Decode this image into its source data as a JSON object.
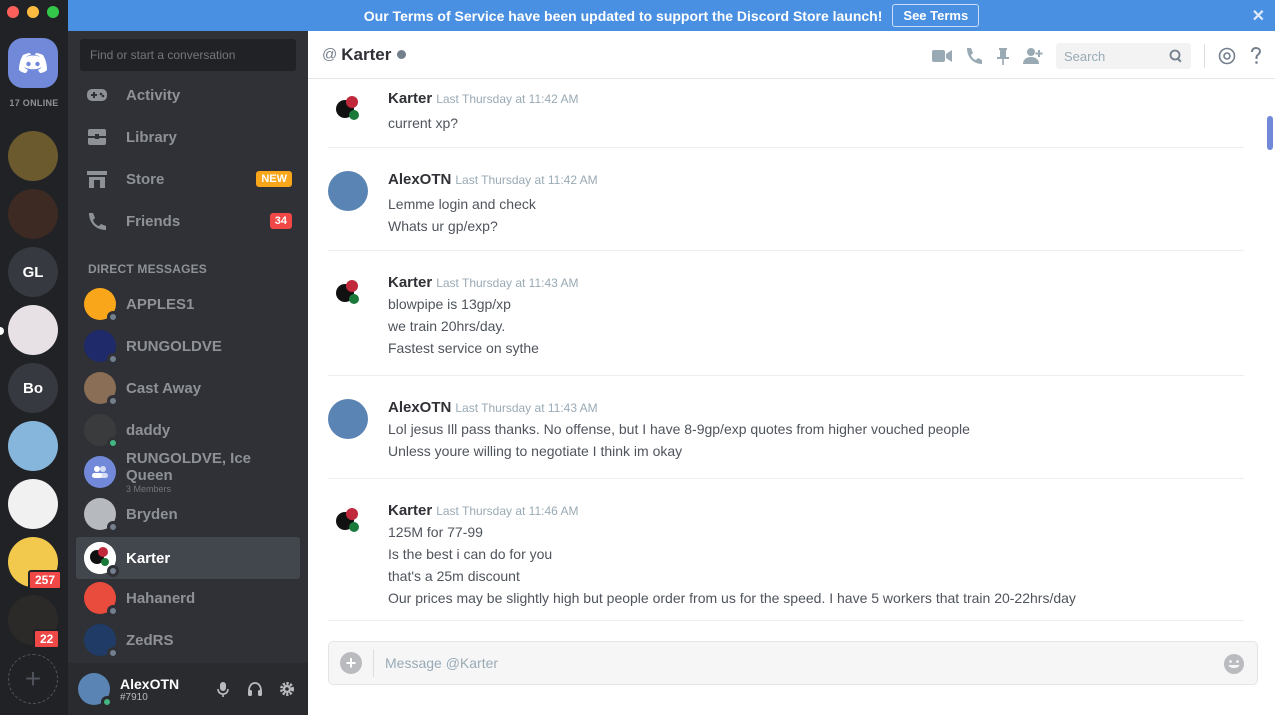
{
  "notice": {
    "text": "Our Terms of Service have been updated to support the Discord Store launch!",
    "button": "See Terms",
    "close": "✕"
  },
  "guilds": {
    "online_count": "17 ONLINE",
    "items": [
      {
        "label": "",
        "color": "#6b5a2e"
      },
      {
        "label": "",
        "color": "#3c2a23"
      },
      {
        "label": "GL",
        "color": "#36393f"
      },
      {
        "label": "",
        "color": "#e7e1e6"
      },
      {
        "label": "Bo",
        "color": "#36393f"
      },
      {
        "label": "",
        "color": "#87b6dc"
      },
      {
        "label": "",
        "color": "#f1f1f1"
      },
      {
        "label": "",
        "color": "#f2c94c",
        "badge": "257"
      },
      {
        "label": "",
        "color": "#2b2a28",
        "badge": "22"
      }
    ],
    "add_label": "+"
  },
  "sidebar": {
    "search_placeholder": "Find or start a conversation",
    "nav": [
      {
        "label": "Activity"
      },
      {
        "label": "Library"
      },
      {
        "label": "Store",
        "tag": "NEW"
      },
      {
        "label": "Friends",
        "tag": "34"
      }
    ],
    "dm_header": "DIRECT MESSAGES",
    "dms": [
      {
        "label": "APPLES1",
        "sub": "",
        "color": "#faa61a",
        "online": false
      },
      {
        "label": "RUNGOLDVE",
        "sub": "",
        "color": "#1e2a6a",
        "online": false
      },
      {
        "label": "Cast Away",
        "sub": "",
        "color": "#8a6e55",
        "online": false
      },
      {
        "label": "daddy",
        "sub": "",
        "color": "#3a3b3c",
        "online": true
      },
      {
        "label": "RUNGOLDVE, Ice Queen",
        "sub": "3 Members",
        "color": "#7289da",
        "online": false
      },
      {
        "label": "Bryden",
        "sub": "",
        "color": "#b6b9bd",
        "online": false
      },
      {
        "label": "Karter",
        "sub": "",
        "color": "#ffffff",
        "online": false
      },
      {
        "label": "Hahanerd",
        "sub": "",
        "color": "#e94b3c",
        "online": false
      },
      {
        "label": "ZedRS",
        "sub": "",
        "color": "#1f3b66",
        "online": false
      }
    ],
    "user": {
      "name": "AlexOTN",
      "discriminator": "#7910"
    }
  },
  "chat": {
    "at": "@",
    "title": "Karter",
    "search_placeholder": "Search",
    "messages": [
      {
        "author": "Karter",
        "time": "Last Thursday at 11:42 AM",
        "lines": [
          "current xp?"
        ]
      },
      {
        "author": "AlexOTN",
        "time": "Last Thursday at 11:42 AM",
        "lines": [
          "Lemme login and check",
          "Whats ur gp/exp?"
        ]
      },
      {
        "author": "Karter",
        "time": "Last Thursday at 11:43 AM",
        "lines": [
          "blowpipe is 13gp/xp",
          "we train 20hrs/day.",
          "Fastest service on sythe"
        ]
      },
      {
        "author": "AlexOTN",
        "time": "Last Thursday at 11:43 AM",
        "lines": [
          "Lol jesus Ill pass thanks. No offense, but I have 8-9gp/exp quotes from higher vouched people",
          "Unless youre willing to negotiate I think im okay"
        ]
      },
      {
        "author": "Karter",
        "time": "Last Thursday at 11:46 AM",
        "lines": [
          "125M for 77-99",
          "Is the best i can do for you",
          "that's a 25m discount",
          "Our prices may be slightly high but people order from us for the speed. I have 5 workers that train 20-22hrs/day"
        ]
      }
    ],
    "composer_placeholder": "Message @Karter"
  },
  "colors": {
    "blurple": "#7289da",
    "notice": "#4a90e2",
    "danger": "#f04747",
    "warning": "#faa61a",
    "online": "#43b581",
    "idle_gray": "#747f8d"
  }
}
